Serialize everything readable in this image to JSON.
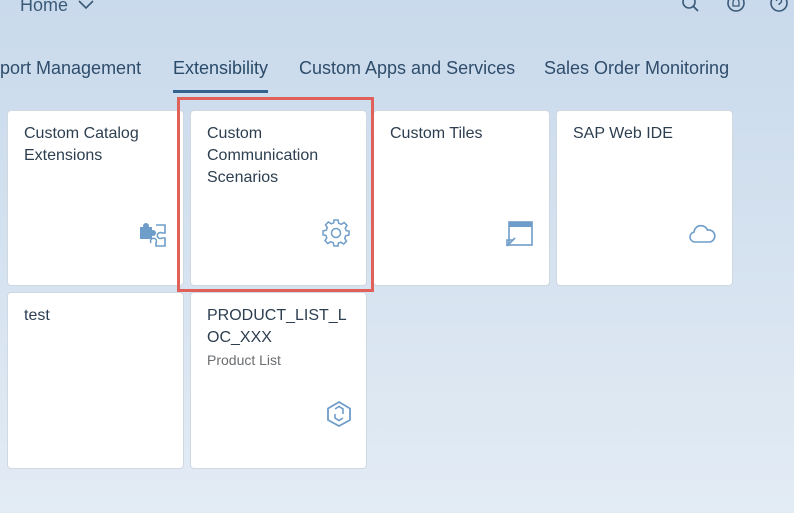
{
  "shell": {
    "home_label": "Home",
    "icons": [
      "search-icon",
      "notifications-icon",
      "help-icon"
    ]
  },
  "tabs": [
    {
      "label": "port Management"
    },
    {
      "label": "Extensibility",
      "active": true
    },
    {
      "label": "Custom Apps and Services"
    },
    {
      "label": "Sales Order Monitoring"
    }
  ],
  "tiles": [
    {
      "title": "Custom Catalog Extensions",
      "icon": "puzzle-icon"
    },
    {
      "title": "Custom Communication Scenarios",
      "icon": "gear-icon",
      "highlighted": true
    },
    {
      "title": "Custom Tiles",
      "icon": "tile-window-icon"
    },
    {
      "title": "SAP Web IDE",
      "icon": "cloud-icon"
    },
    {
      "title": "test"
    },
    {
      "title": "PRODUCT_LIST_LOC_XXX",
      "title_display": "PRODUCT_LIST_L\nOC_XXX",
      "subtitle": "Product List",
      "icon": "cube-icon"
    }
  ],
  "colors": {
    "accent": "#34628f",
    "highlight": "#e0615a",
    "icon": "#6f9dc9"
  }
}
